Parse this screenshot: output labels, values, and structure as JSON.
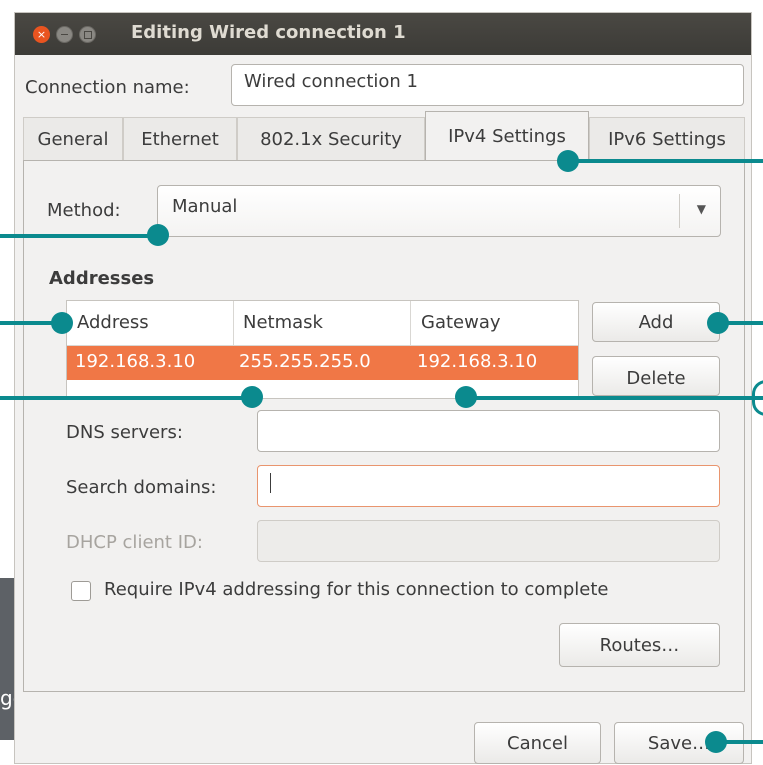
{
  "window": {
    "title": "Editing Wired connection 1",
    "buttons": {
      "close": "close-icon",
      "minimize": "minimize-icon",
      "maximize": "maximize-icon"
    }
  },
  "connection": {
    "name_label": "Connection name:",
    "name_value": "Wired connection 1"
  },
  "tabs": [
    {
      "label": "General"
    },
    {
      "label": "Ethernet"
    },
    {
      "label": "802.1x Security"
    },
    {
      "label": "IPv4 Settings",
      "active": true
    },
    {
      "label": "IPv6 Settings"
    }
  ],
  "ipv4": {
    "method_label": "Method:",
    "method_value": "Manual",
    "addresses_heading": "Addresses",
    "columns": [
      "Address",
      "Netmask",
      "Gateway"
    ],
    "rows": [
      {
        "address": "192.168.3.10",
        "netmask": "255.255.255.0",
        "gateway": "192.168.3.10"
      }
    ],
    "add_label": "Add",
    "delete_label": "Delete",
    "dns_label": "DNS servers:",
    "dns_value": "",
    "search_label": "Search domains:",
    "search_value": "",
    "dhcp_label": "DHCP client ID:",
    "dhcp_value": "",
    "require_label": "Require IPv4 addressing for this connection to complete",
    "routes_label": "Routes…"
  },
  "footer": {
    "cancel_label": "Cancel",
    "save_label": "Save…"
  },
  "background": {
    "partial_text": "get"
  },
  "colors": {
    "accent": "#f07746",
    "callout": "#0b8a8e",
    "titlebar": "#3c3b37",
    "close_button": "#e95420"
  }
}
